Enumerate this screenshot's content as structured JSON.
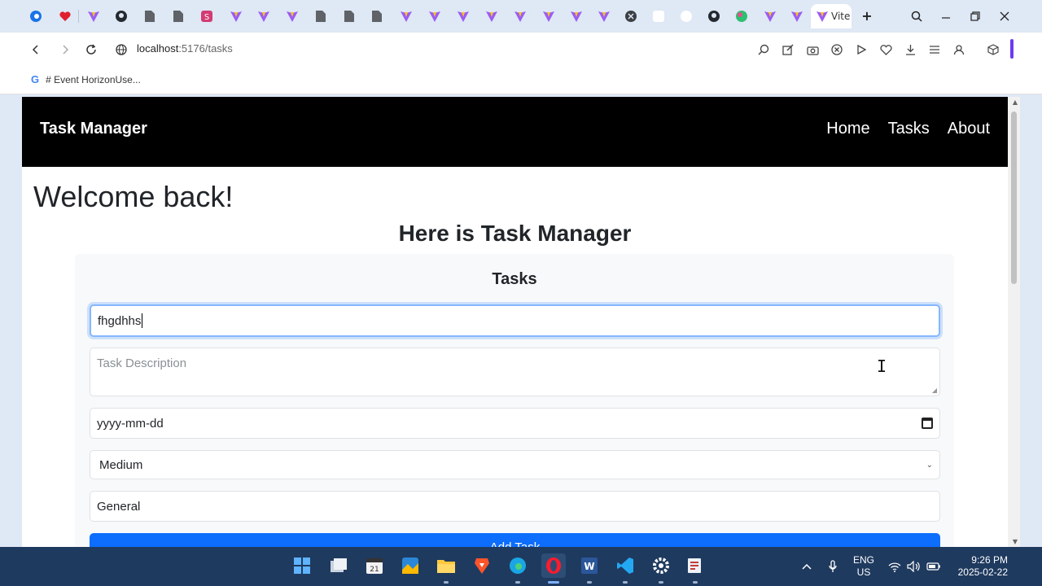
{
  "browser": {
    "active_tab_label": "Vite",
    "new_tab_symbol": "+",
    "url_host": "localhost",
    "url_path": ":5176/tasks",
    "bookmark_label": "# Event HorizonUse..."
  },
  "app": {
    "brand": "Task Manager",
    "nav": [
      "Home",
      "Tasks",
      "About"
    ],
    "welcome": "Welcome back!",
    "subheading": "Here is Task Manager",
    "card_title": "Tasks",
    "form": {
      "title_value": "fhgdhhs",
      "description_placeholder": "Task Description",
      "date_placeholder": "yyyy-mm-dd",
      "priority_value": "Medium",
      "category_value": "General",
      "submit_label": "Add Task"
    }
  },
  "taskbar": {
    "language": "ENG",
    "region": "US",
    "time": "9:26 PM",
    "date": "2025-02-22"
  },
  "colors": {
    "navbar": "#000000",
    "accent": "#0d6efd",
    "focus_ring": "#86b7fe",
    "taskbar": "#1f3a5f"
  }
}
